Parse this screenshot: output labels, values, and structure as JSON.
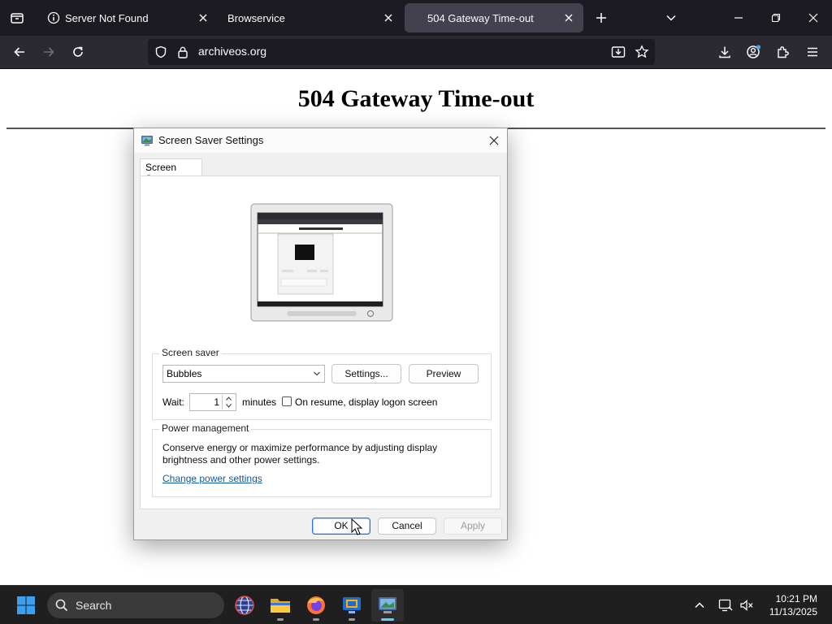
{
  "browser": {
    "tabs": [
      {
        "title": "Server Not Found",
        "active": false
      },
      {
        "title": "Browservice",
        "active": false
      },
      {
        "title": "504 Gateway Time-out",
        "active": true
      }
    ],
    "url": "archiveos.org"
  },
  "page": {
    "heading": "504 Gateway Time-out"
  },
  "dialog": {
    "title": "Screen Saver Settings",
    "tab_label": "Screen Saver",
    "screen_saver": {
      "group_label": "Screen saver",
      "selected": "Bubbles",
      "settings_label": "Settings...",
      "preview_label": "Preview",
      "wait_label": "Wait:",
      "wait_value": "1",
      "minutes_label": "minutes",
      "resume_label": "On resume, display logon screen",
      "resume_checked": false
    },
    "power": {
      "group_label": "Power management",
      "description": "Conserve energy or maximize performance by adjusting display brightness and other power settings.",
      "link": "Change power settings"
    },
    "buttons": {
      "ok": "OK",
      "cancel": "Cancel",
      "apply": "Apply"
    }
  },
  "taskbar": {
    "search_placeholder": "Search",
    "apps": [
      "vpn-globe",
      "file-explorer",
      "firefox",
      "remote-desktop",
      "screen-saver-settings"
    ],
    "time": "10:21 PM",
    "date": "11/13/2025"
  },
  "colors": {
    "tabbar": "#1c1b22",
    "navbar": "#2b2a33",
    "active_tab": "#42414d",
    "taskbar": "#1f1f1f",
    "link": "#0f5aa6",
    "accent": "#60cdff"
  }
}
